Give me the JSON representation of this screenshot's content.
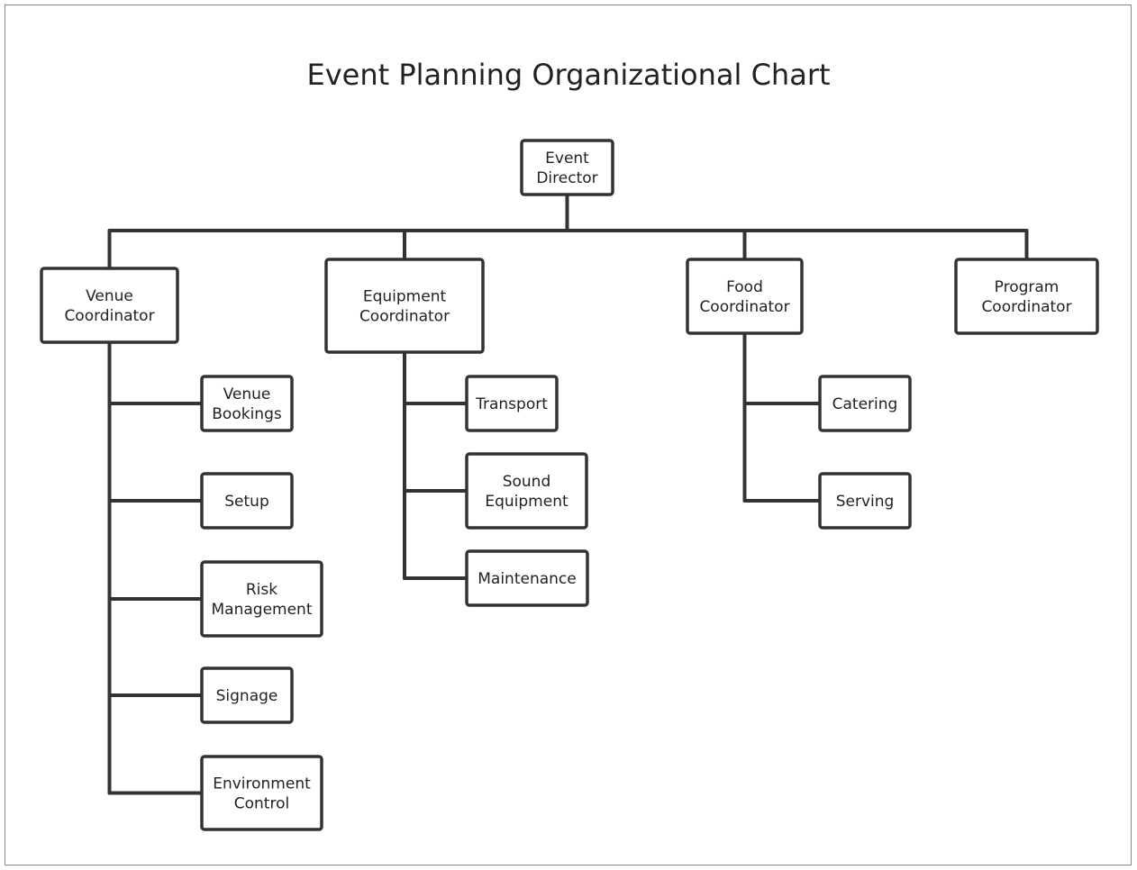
{
  "title": "Event Planning Organizational Chart",
  "colors": {
    "line": "#333333",
    "box_fill": "#ffffff",
    "frame": "#8a8a8a",
    "text": "#222222"
  },
  "org": {
    "root": {
      "id": "event-director",
      "label": [
        "Event",
        "Director"
      ]
    },
    "coordinators": [
      {
        "id": "venue-coordinator",
        "label": [
          "Venue",
          "Coordinator"
        ],
        "children": [
          {
            "id": "venue-bookings",
            "label": [
              "Venue",
              "Bookings"
            ]
          },
          {
            "id": "setup",
            "label": [
              "Setup"
            ]
          },
          {
            "id": "risk-management",
            "label": [
              "Risk",
              "Management"
            ]
          },
          {
            "id": "signage",
            "label": [
              "Signage"
            ]
          },
          {
            "id": "environment-control",
            "label": [
              "Environment",
              "Control"
            ]
          }
        ]
      },
      {
        "id": "equipment-coordinator",
        "label": [
          "Equipment",
          "Coordinator"
        ],
        "children": [
          {
            "id": "transport",
            "label": [
              "Transport"
            ]
          },
          {
            "id": "sound-equipment",
            "label": [
              "Sound",
              "Equipment"
            ]
          },
          {
            "id": "maintenance",
            "label": [
              "Maintenance"
            ]
          }
        ]
      },
      {
        "id": "food-coordinator",
        "label": [
          "Food",
          "Coordinator"
        ],
        "children": [
          {
            "id": "catering",
            "label": [
              "Catering"
            ]
          },
          {
            "id": "serving",
            "label": [
              "Serving"
            ]
          }
        ]
      },
      {
        "id": "program-coordinator",
        "label": [
          "Program",
          "Coordinator"
        ],
        "children": []
      }
    ]
  }
}
